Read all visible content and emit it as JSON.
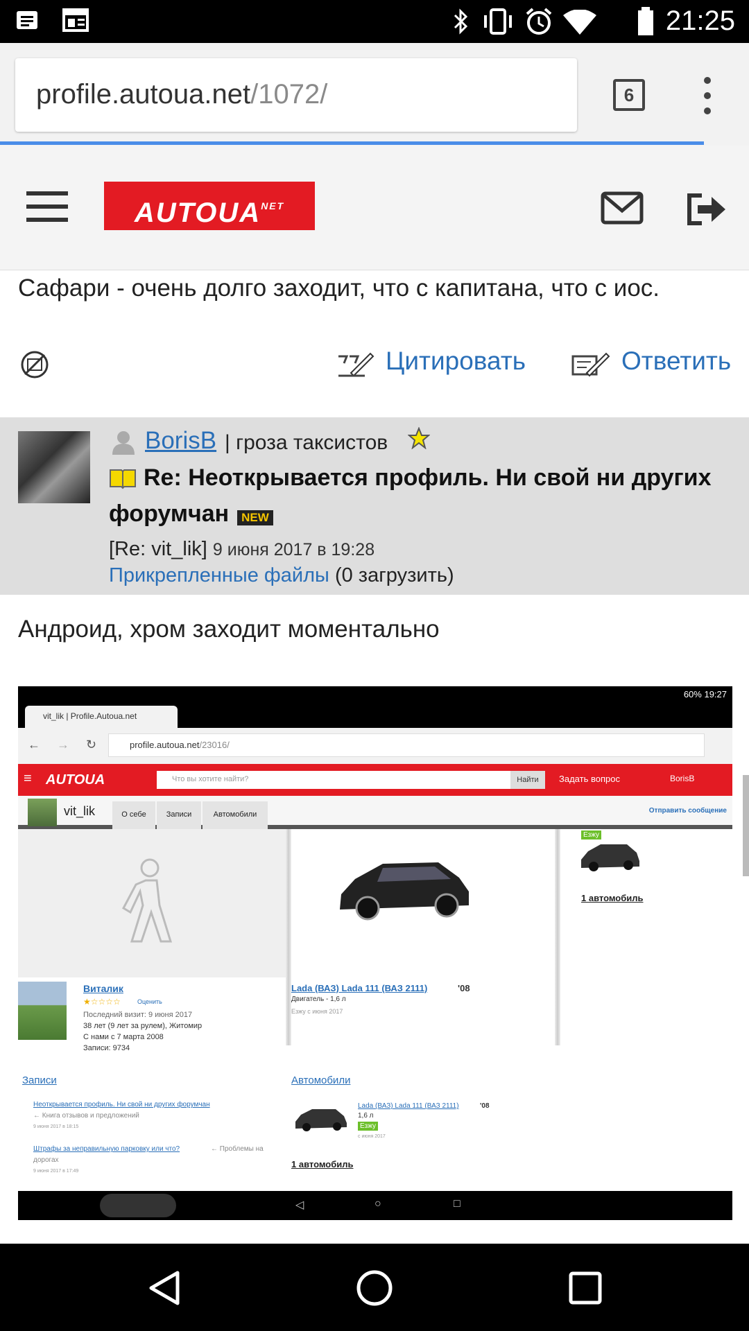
{
  "status_bar": {
    "time": "21:25"
  },
  "browser": {
    "url_host": "profile.autoua.net",
    "url_path": "/1072/",
    "tab_count": "6"
  },
  "site": {
    "logo": "AUTOUA",
    "logo_sup": "NET"
  },
  "prev_post": {
    "text": "Сафари - очень долго заходит, что с капитана, что с иос.",
    "quote_label": "Цитировать",
    "reply_label": "Ответить"
  },
  "reply": {
    "username": "BorisB",
    "rank": "| гроза таксистов",
    "title_line1": "Re: Неоткрывается профиль. Ни свой ни других",
    "title_line2": "форумчан",
    "new_badge": "NEW",
    "meta_prefix": "[Re: vit_lik]",
    "meta_date": "9 июня 2017 в 19:28",
    "files_link": "Прикрепленные файлы",
    "files_count": "(0 загрузить)",
    "text": "Андроид, хром заходит моментально"
  },
  "embedded_screenshot": {
    "time": "60% 19:27",
    "tab_title": "vit_lik | Profile.Autoua.net",
    "url_host": "profile.autoua.net",
    "url_path": "/23016/",
    "logo": "AUTOUA",
    "search_placeholder": "Что вы хотите найти?",
    "search_button": "Найти",
    "ask_question": "Задать вопрос",
    "account": "BorisB",
    "profile_name": "vit_lik",
    "tabs": [
      "О себе",
      "Записи",
      "Автомобили"
    ],
    "send_message": "Отправить сообщение",
    "user_name": "Виталик",
    "rate": "Оценить",
    "last_visit": "Последний визит: 9 июня 2017",
    "age_city": "38 лет (9 лет за рулем), Житомир",
    "since": "С нами с 7 марта 2008",
    "posts": "Записи: 9734",
    "car_title": "Lada (ВАЗ) Lada 111 (ВАЗ 2111)",
    "car_year": "'08",
    "engine": "Двигатель - 1,6 л",
    "drive_since": "Езжу с июня 2017",
    "badge_drive": "Езжу",
    "one_car": "1 автомобиль",
    "section_posts": "Записи",
    "section_cars": "Автомобили",
    "post1": "Неоткрывается профиль. Ни свой ни других форумчан",
    "post1_cat": "← Книга отзывов и предложений",
    "post1_date": "9 июня 2017 в 18:15",
    "post2": "Штрафы за неправильную парковку или что?",
    "post2_cat": "← Проблемы на",
    "post2_cat2": "дорогах",
    "post2_date": "9 июня 2017 в 17:49",
    "car_small_title": "Lada (ВАЗ) Lada 111 (ВАЗ 2111)",
    "car_small_year": "'08",
    "car_small_engine": "1,6 л",
    "car_small_since": "с июня 2017",
    "one_car_bottom": "1 автомобиль"
  }
}
